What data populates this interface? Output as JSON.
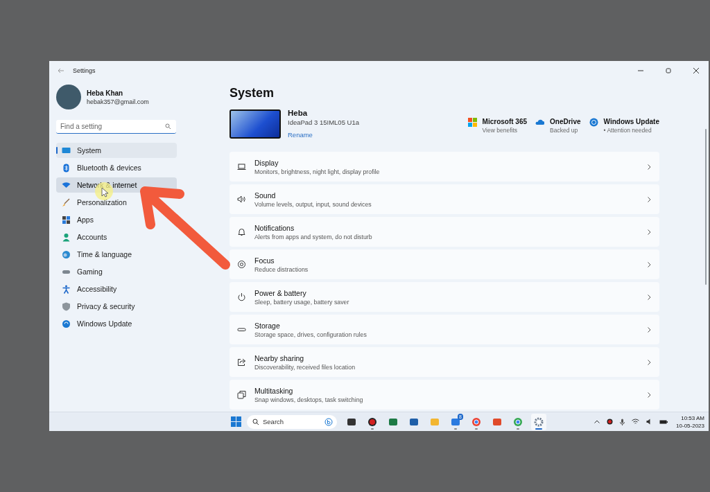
{
  "window": {
    "title": "Settings"
  },
  "account": {
    "name": "Heba Khan",
    "email": "hebak357@gmail.com"
  },
  "search": {
    "placeholder": "Find a setting"
  },
  "sidebar": {
    "items": [
      {
        "label": "System",
        "selected": true,
        "hovered": false
      },
      {
        "label": "Bluetooth & devices",
        "selected": false,
        "hovered": false
      },
      {
        "label": "Network & internet",
        "selected": false,
        "hovered": true
      },
      {
        "label": "Personalization",
        "selected": false,
        "hovered": false
      },
      {
        "label": "Apps",
        "selected": false,
        "hovered": false
      },
      {
        "label": "Accounts",
        "selected": false,
        "hovered": false
      },
      {
        "label": "Time & language",
        "selected": false,
        "hovered": false
      },
      {
        "label": "Gaming",
        "selected": false,
        "hovered": false
      },
      {
        "label": "Accessibility",
        "selected": false,
        "hovered": false
      },
      {
        "label": "Privacy & security",
        "selected": false,
        "hovered": false
      },
      {
        "label": "Windows Update",
        "selected": false,
        "hovered": false
      }
    ]
  },
  "page_title": "System",
  "device": {
    "name": "Heba",
    "model": "IdeaPad 3 15IML05 U1a",
    "rename": "Rename"
  },
  "services": [
    {
      "title": "Microsoft 365",
      "subtitle": "View benefits"
    },
    {
      "title": "OneDrive",
      "subtitle": "Backed up"
    },
    {
      "title": "Windows Update",
      "subtitle": "• Attention needed"
    }
  ],
  "settings": [
    {
      "title": "Display",
      "subtitle": "Monitors, brightness, night light, display profile"
    },
    {
      "title": "Sound",
      "subtitle": "Volume levels, output, input, sound devices"
    },
    {
      "title": "Notifications",
      "subtitle": "Alerts from apps and system, do not disturb"
    },
    {
      "title": "Focus",
      "subtitle": "Reduce distractions"
    },
    {
      "title": "Power & battery",
      "subtitle": "Sleep, battery usage, battery saver"
    },
    {
      "title": "Storage",
      "subtitle": "Storage space, drives, configuration rules"
    },
    {
      "title": "Nearby sharing",
      "subtitle": "Discoverability, received files location"
    },
    {
      "title": "Multitasking",
      "subtitle": "Snap windows, desktops, task switching"
    }
  ],
  "taskbar": {
    "search_placeholder": "Search",
    "apps": [
      {
        "running": false,
        "selected": false
      },
      {
        "running": true,
        "selected": false
      },
      {
        "running": false,
        "selected": false
      },
      {
        "running": false,
        "selected": false
      },
      {
        "running": false,
        "selected": false
      },
      {
        "running": true,
        "selected": false,
        "badge": "8"
      },
      {
        "running": true,
        "selected": false
      },
      {
        "running": false,
        "selected": false
      },
      {
        "running": true,
        "selected": false
      },
      {
        "running": true,
        "selected": true
      }
    ],
    "time": "10:53 AM",
    "date": "10-05-2023"
  }
}
